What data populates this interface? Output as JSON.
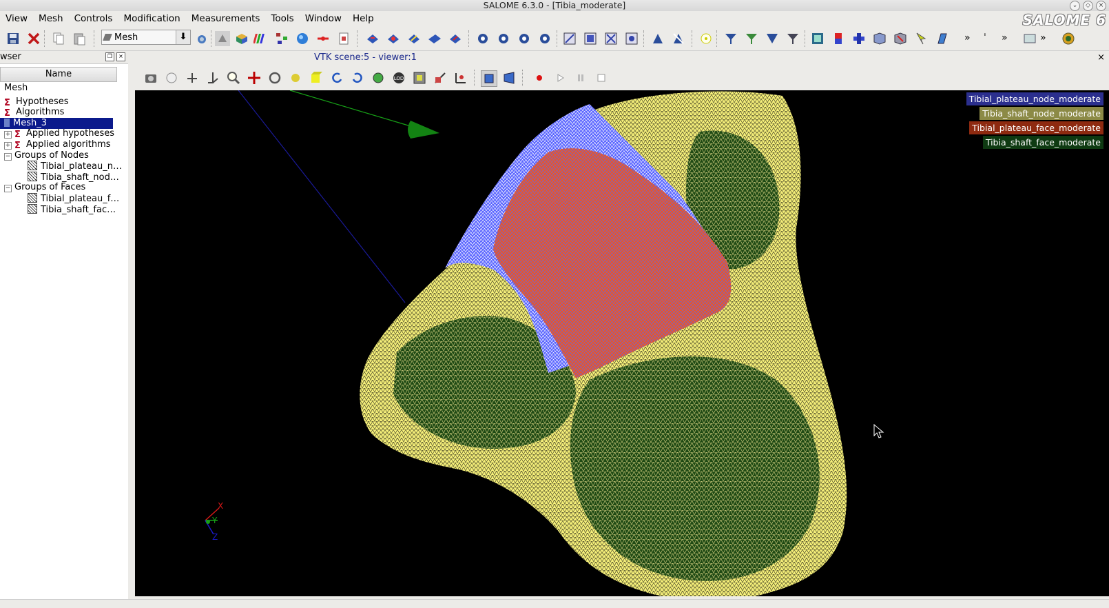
{
  "window": {
    "title": "SALOME 6.3.0 - [Tibia_moderate]",
    "logo": "SALOME 6"
  },
  "menu": [
    "View",
    "Mesh",
    "Controls",
    "Modification",
    "Measurements",
    "Tools",
    "Window",
    "Help"
  ],
  "toolbar": {
    "module_value": "Mesh"
  },
  "browser": {
    "title": "wser",
    "column_header": "Name",
    "tree": [
      {
        "label": "Mesh",
        "level": 0,
        "icon": "none",
        "expander": ""
      },
      {
        "label": "Hypotheses",
        "level": 0,
        "icon": "sigma-icon",
        "expander": ""
      },
      {
        "label": "Algorithms",
        "level": 0,
        "icon": "sigma-icon",
        "expander": ""
      },
      {
        "label": "Mesh_3",
        "level": 0,
        "icon": "mesh-icon",
        "expander": "",
        "selected": true
      },
      {
        "label": "Applied hypotheses",
        "level": 1,
        "icon": "sigma-icon",
        "expander": "+"
      },
      {
        "label": "Applied algorithms",
        "level": 1,
        "icon": "sigma-icon",
        "expander": "+"
      },
      {
        "label": "Groups of Nodes",
        "level": 1,
        "icon": "none",
        "expander": "−"
      },
      {
        "label": "Tibial_plateau_n…",
        "level": 2,
        "icon": "group-icon",
        "expander": ""
      },
      {
        "label": "Tibia_shaft_nod…",
        "level": 2,
        "icon": "group-icon",
        "expander": ""
      },
      {
        "label": "Groups of Faces",
        "level": 1,
        "icon": "none",
        "expander": "−"
      },
      {
        "label": "Tibial_plateau_f…",
        "level": 2,
        "icon": "group-icon",
        "expander": ""
      },
      {
        "label": "Tibia_shaft_fac…",
        "level": 2,
        "icon": "group-icon",
        "expander": ""
      }
    ]
  },
  "viewer": {
    "tab_title": "VTK scene:5 - viewer:1",
    "axis_labels": {
      "x": "X",
      "y": "Y",
      "z": "Z"
    },
    "legend": [
      {
        "label": "Tibial_plateau_node_moderate",
        "color": "#2b2f8e"
      },
      {
        "label": "Tibia_shaft_node_moderate",
        "color": "#8c8a46"
      },
      {
        "label": "Tibial_plateau_face_moderate",
        "color": "#8e2a10"
      },
      {
        "label": "Tibia_shaft_face_moderate",
        "color": "#0e3a12"
      }
    ],
    "colors": {
      "mesh_yellow": "#f6f07a",
      "mesh_blue": "#5b66ff",
      "mesh_orange": "#e8562a",
      "mesh_green": "#1f4a14"
    }
  }
}
